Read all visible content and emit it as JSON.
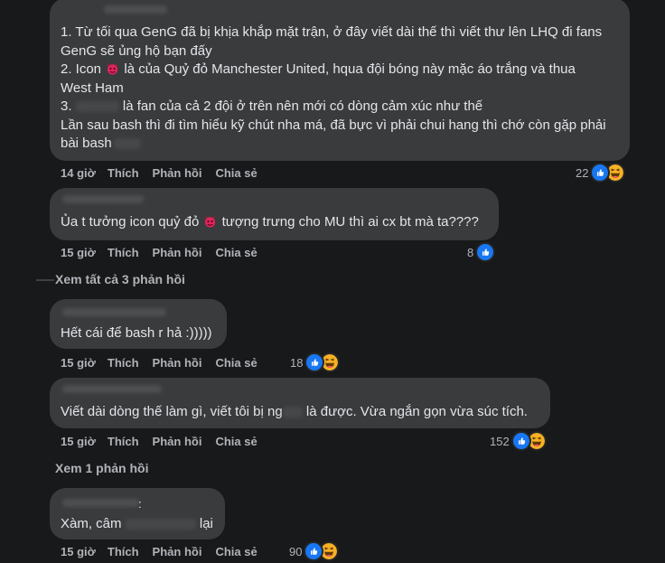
{
  "comments": [
    {
      "lines": [
        "1. Từ tối qua GenG đã bị khịa khắp mặt trận, ở đây viết dài thế thì viết thư lên LHQ đi fans",
        "GenG sẽ ủng hộ bạn đấy",
        "2. Icon ",
        " là của Quỷ đỏ Manchester United, hqua đội bóng này mặc áo trắng và thua",
        "West Ham",
        "3. ",
        " là fan của cả 2 đội ở trên nên mới có dòng cảm xúc như thế",
        "Lần sau bash thì đi tìm hiểu kỹ chút nha má, đã bực vì phải chui hang thì chớ còn gặp phải",
        "bài bash"
      ],
      "time": "14 giờ",
      "reaction_count": "22",
      "reactions": [
        "like",
        "haha"
      ]
    },
    {
      "text_before_icon": "Ủa t tưởng icon quỷ đỏ ",
      "text_after_icon": " tượng trưng cho MU thì ai cx bt mà ta????",
      "time": "15 giờ",
      "reaction_count": "8",
      "reactions": [
        "like"
      ]
    },
    {
      "text": "Hết cái để bash r hả :)))))",
      "time": "15 giờ",
      "reaction_count": "18",
      "reactions": [
        "like",
        "haha"
      ]
    },
    {
      "text_before": "Viết dài dòng thế làm gì, viết tôi bị ng",
      "text_after": " là được. Vừa ngắn gọn vừa súc tích.",
      "time": "15 giờ",
      "reaction_count": "152",
      "reactions": [
        "like",
        "haha"
      ]
    },
    {
      "name_suffix": ":",
      "text_before": "Xàm, câm ",
      "text_after": " lại",
      "time": "15 giờ",
      "reaction_count": "90",
      "reactions": [
        "like",
        "haha"
      ]
    }
  ],
  "actions": {
    "like": "Thích",
    "reply": "Phản hồi",
    "share": "Chia sẻ"
  },
  "see_more": [
    "Xem tất cả 3 phản hồi",
    "Xem 1 phản hồi"
  ],
  "colors": {
    "background": "#18191a",
    "bubble": "#3a3b3c",
    "like": "#1877f2",
    "haha": "#f7b125",
    "devil": "#e0245e"
  },
  "icons": [
    "red-devil-emoji",
    "like-reaction-icon",
    "haha-reaction-icon"
  ]
}
